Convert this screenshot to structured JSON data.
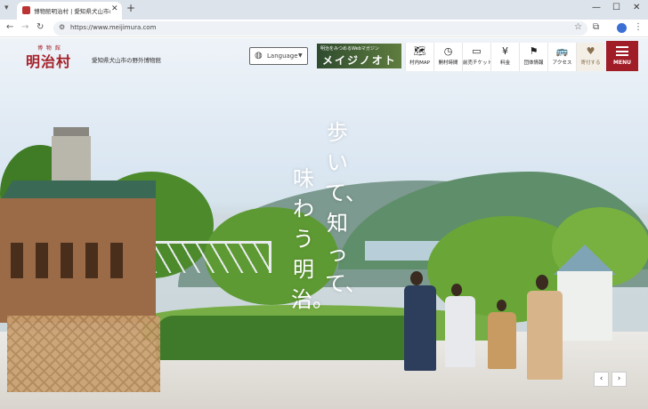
{
  "browser": {
    "tab_title": "博物館明治村 | 愛知県犬山市の野外博物館",
    "close_tab": "✕",
    "new_tab": "+",
    "url": "https://www.meijimura.com"
  },
  "site": {
    "logo_kana": "博 物 館",
    "logo": "明治村",
    "tagline": "愛知県犬山市の野外博物館",
    "language_label": "Language",
    "banner_top": "明治をみつめるWebマガジン",
    "banner_title": "メイジノオト",
    "nav": [
      {
        "icon": "map-icon",
        "glyph": "🗺",
        "label": "村内MAP"
      },
      {
        "icon": "clock-icon",
        "glyph": "◷",
        "label": "開村時間"
      },
      {
        "icon": "ticket-icon",
        "glyph": "▭",
        "label": "前売チケット"
      },
      {
        "icon": "yen-icon",
        "glyph": "¥",
        "label": "料金"
      },
      {
        "icon": "flag-icon",
        "glyph": "⚑",
        "label": "団体情報"
      },
      {
        "icon": "bus-icon",
        "glyph": "🚌",
        "label": "アクセス"
      },
      {
        "icon": "heart-icon",
        "glyph": "♥",
        "label": "寄付する"
      }
    ],
    "menu_label": "MENU"
  },
  "hero": {
    "line1": "歩いて、知って、",
    "line2": "味わう明治。"
  },
  "carousel": {
    "prev": "‹",
    "next": "›"
  },
  "colors": {
    "brand_red": "#a5212a",
    "menu_red": "#a01c26"
  }
}
